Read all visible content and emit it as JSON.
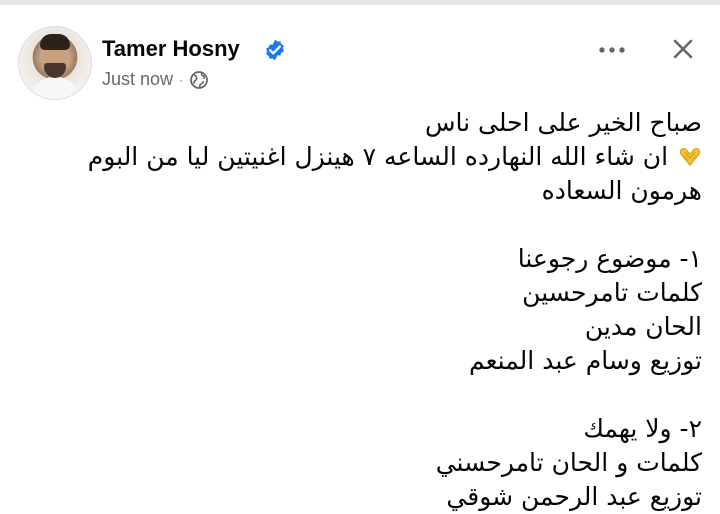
{
  "post": {
    "author": "Tamer Hosny",
    "time": "Just now",
    "separator": "·",
    "verified": true,
    "audience_icon": "globe-icon",
    "accent_color": "#1877f2",
    "lines": [
      "صباح الخير على احلى ناس",
      "ان شاء الله النهارده الساعه ٧  هينزل اغنيتين ليا من البوم هرمون السعاده",
      "١- موضوع رجوعنا",
      "كلمات تامرحسين",
      "الحان مدين",
      "توزيع وسام عبد المنعم",
      "٢- ولا يهمك",
      "كلمات و الحان تامرحسني",
      "توزيع عبد الرحمن شوقي"
    ],
    "emoji": "heart-hands-emoji"
  },
  "actions": {
    "more_icon": "more-icon",
    "close_icon": "close-icon"
  }
}
